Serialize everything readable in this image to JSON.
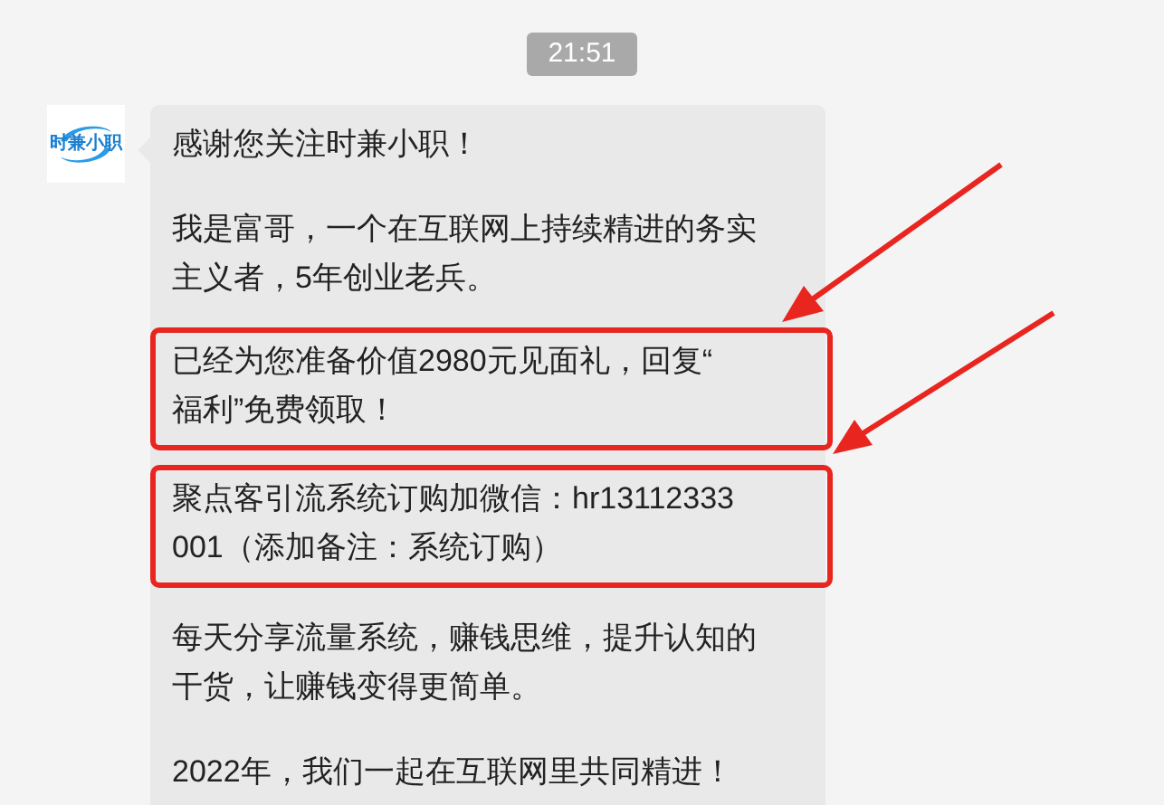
{
  "time": "21:51",
  "avatar": {
    "logo_text": "时兼小职"
  },
  "paragraphs": [
    {
      "lines": [
        "感谢您关注时兼小职！"
      ],
      "highlighted": false
    },
    {
      "lines": [
        "我是富哥，一个在互联网上持续精进的务实",
        "主义者，5年创业老兵。"
      ],
      "highlighted": false
    },
    {
      "lines": [
        "已经为您准备价值2980元见面礼，回复“",
        "福利”免费领取！"
      ],
      "highlighted": true
    },
    {
      "lines": [
        "聚点客引流系统订购加微信：hr13112333",
        "001（添加备注：系统订购）"
      ],
      "highlighted": true
    },
    {
      "lines": [
        "每天分享流量系统，赚钱思维，提升认知的",
        "干货，让赚钱变得更简单。"
      ],
      "highlighted": false
    },
    {
      "lines": [
        "2022年，我们一起在互联网里共同精进！"
      ],
      "highlighted": false
    }
  ]
}
